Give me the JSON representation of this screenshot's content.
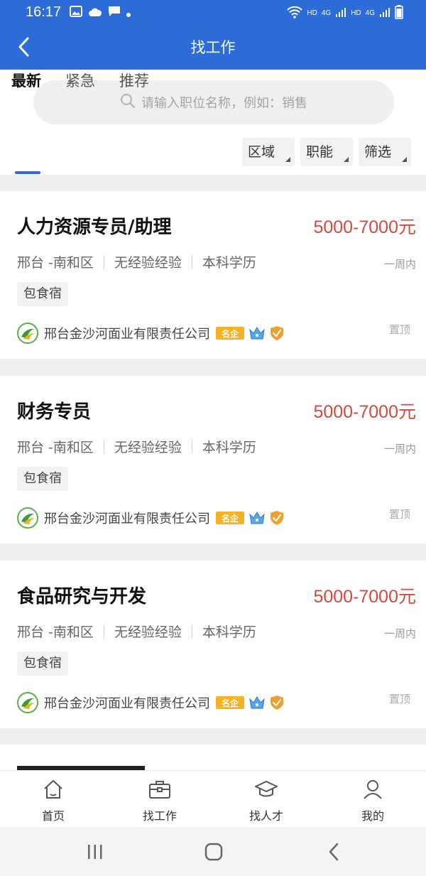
{
  "status_bar": {
    "time": "16:17",
    "hd1": "HD",
    "net1": "4G",
    "hd2": "HD",
    "net2": "4G"
  },
  "header": {
    "title": "找工作"
  },
  "search": {
    "placeholder": "请输入职位名称，例如：销售"
  },
  "tabs": [
    {
      "label": "最新",
      "active": true
    },
    {
      "label": "紧急",
      "active": false
    },
    {
      "label": "推荐",
      "active": false
    }
  ],
  "filters": [
    {
      "label": "区域"
    },
    {
      "label": "职能"
    },
    {
      "label": "筛选"
    }
  ],
  "jobs": [
    {
      "title": "人力资源专员/助理",
      "salary": "5000-7000元",
      "location": "邢台 -南和区",
      "experience": "无经验经验",
      "education": "本科学历",
      "posted": "一周内",
      "tag": "包食宿",
      "company": "邢台金沙河面业有限责任公司",
      "badge": "名企",
      "pinned": "置顶"
    },
    {
      "title": "财务专员",
      "salary": "5000-7000元",
      "location": "邢台 -南和区",
      "experience": "无经验经验",
      "education": "本科学历",
      "posted": "一周内",
      "tag": "包食宿",
      "company": "邢台金沙河面业有限责任公司",
      "badge": "名企",
      "pinned": "置顶"
    },
    {
      "title": "食品研究与开发",
      "salary": "5000-7000元",
      "location": "邢台 -南和区",
      "experience": "无经验经验",
      "education": "本科学历",
      "posted": "一周内",
      "tag": "包食宿",
      "company": "邢台金沙河面业有限责任公司",
      "badge": "名企",
      "pinned": "置顶"
    }
  ],
  "bottom_nav": [
    {
      "label": "首页",
      "icon": "home-icon"
    },
    {
      "label": "找工作",
      "icon": "briefcase-icon"
    },
    {
      "label": "找人才",
      "icon": "graduation-cap-icon"
    },
    {
      "label": "我的",
      "icon": "person-icon"
    }
  ],
  "colors": {
    "primary": "#2d6cd9",
    "salary": "#d24a3e",
    "badge": "#f5b323",
    "shield": "#f0a030"
  }
}
